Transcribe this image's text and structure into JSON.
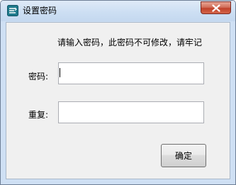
{
  "window": {
    "title": "设置密码",
    "icon": "app-logo-icon",
    "close_icon": "close-icon"
  },
  "dialog": {
    "prompt": "请输入密码，此密码不可修改，请牢记",
    "password_label": "密码:",
    "password_value": "",
    "confirm_label": "重复:",
    "confirm_value": "",
    "ok_label": "确定"
  },
  "colors": {
    "titlebar": "#cddff3",
    "client_bg": "#f0f0f0",
    "close_button": "#c0412a"
  }
}
